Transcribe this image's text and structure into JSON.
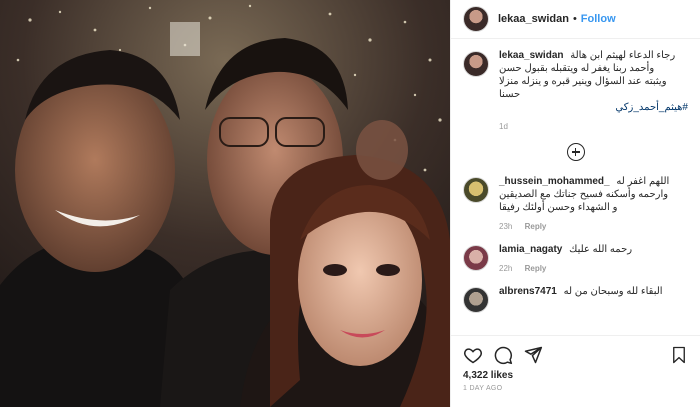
{
  "post": {
    "username": "lekaa_swidan",
    "separator": "•",
    "follow_label": "Follow",
    "likes": "4,322 likes",
    "date": "1 DAY AGO"
  },
  "caption": {
    "username": "lekaa_swidan",
    "text": "رجاء الدعاء لهيثم ابن هالة\nوأحمد ربنا يغفر له ويتقبله بقبول حسن\nويثبته عند السؤال وينير قبره و ينزله منزلا\nحسنا",
    "hashtag": "#هيثم_أحمد_زكي",
    "time": "1d"
  },
  "comments": [
    {
      "username": "_hussein_mohammed_",
      "text": "اللهم اغفر له\nوارحمه وأسكنه فسيح جناتك مع الصديقين\nو الشهداء وحسن أولئك رفيقا",
      "time": "23h",
      "reply": "Reply"
    },
    {
      "username": "lamia_nagaty",
      "text": "رحمه الله عليك",
      "time": "22h",
      "reply": "Reply"
    },
    {
      "username": "albrens7471",
      "text": "البقاء لله وسبحان من له",
      "time": "",
      "reply": ""
    }
  ],
  "icons": [
    "heart-icon",
    "comment-icon",
    "share-icon",
    "bookmark-icon",
    "load-more-icon"
  ],
  "colors": {
    "link": "#3897f0",
    "muted": "#999999",
    "text": "#262626",
    "border": "#efefef"
  }
}
